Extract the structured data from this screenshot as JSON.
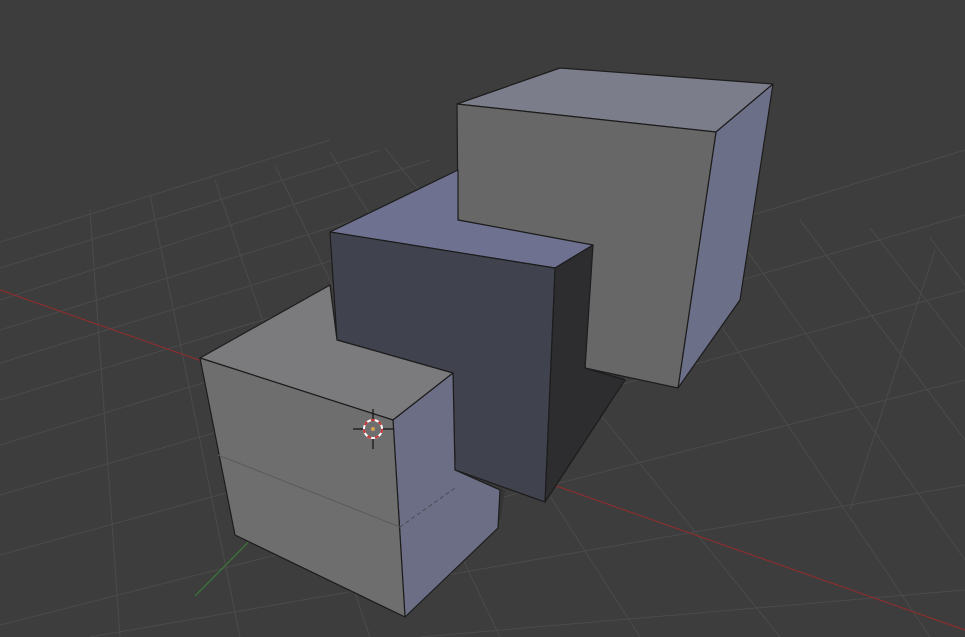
{
  "app": {
    "view": "3d-viewport",
    "background_color": "#3d3d3d"
  },
  "scene": {
    "grid": {
      "visible": true,
      "line_color": "#4b4b4b",
      "x_axis_color": "#8a2e2e",
      "y_axis_color": "#3a7a3a"
    },
    "objects": [
      {
        "name": "cube-large",
        "top_color": "#7c7d8a",
        "front_color": "#676767",
        "side_color": "#6c6f88"
      },
      {
        "name": "cube-middle",
        "top_color": "#6e7290",
        "front_color": "#40424e",
        "side_color": "#2d2d30"
      },
      {
        "name": "cube-small",
        "top_color": "#7b7b7d",
        "front_color": "#6e6e6e",
        "side_color": "#6c6e86"
      }
    ],
    "shadow_color": "#333333",
    "edge_color": "#1c1c1c",
    "cursor": {
      "icon": "3d-cursor-icon",
      "ring_color": "#c83232",
      "ring_alt_color": "#ffffff",
      "crosshair_color": "#111111"
    }
  }
}
